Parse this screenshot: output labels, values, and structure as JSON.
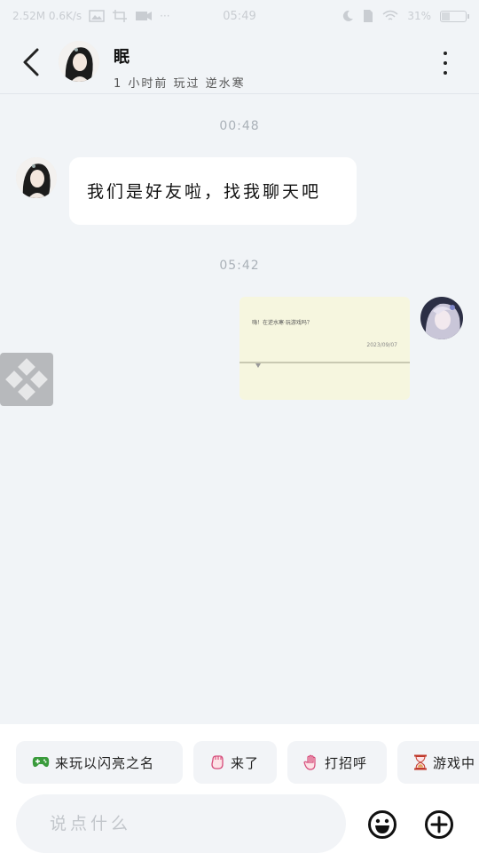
{
  "status_bar": {
    "left_text": "2.52M 0.6K/s",
    "time": "05:49",
    "battery_percent": "31%",
    "battery_level": 0.31
  },
  "header": {
    "contact_name": "眠",
    "contact_status": "1 小时前 玩过 逆水寒"
  },
  "messages": [
    {
      "timestamp": "00:48",
      "direction": "incoming",
      "text": "我们是好友啦，找我聊天吧"
    },
    {
      "timestamp": "05:42",
      "direction": "outgoing",
      "card_text": "嗨！在逆水寒·玩游戏吗？",
      "card_date": "2023/09/07"
    }
  ],
  "quick_replies": [
    {
      "label": "来玩以闪亮之名",
      "icon": "gamepad-icon"
    },
    {
      "label": "来了",
      "icon": "fist-hand-icon"
    },
    {
      "label": "打招呼",
      "icon": "waving-hand-icon"
    },
    {
      "label": "游戏中",
      "icon": "hourglass-icon"
    }
  ],
  "composer": {
    "placeholder": "说点什么"
  },
  "colors": {
    "background": "#f1f4f7",
    "bubble_incoming": "#ffffff",
    "card_background": "#f6f6df",
    "gamepad": "#3a9b3c",
    "accent_pink": "#d64b7a"
  }
}
